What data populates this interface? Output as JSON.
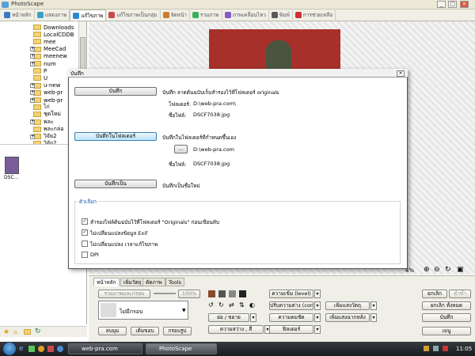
{
  "app": {
    "title": "PhotoScape"
  },
  "tabs": [
    {
      "label": "หน้าหลัก",
      "color": "#3a78c8"
    },
    {
      "label": "แสดงภาพ",
      "color": "#3aa0c8"
    },
    {
      "label": "แก้ไขภาพ",
      "color": "#2a8ad0"
    },
    {
      "label": "แก้ไขภาพเป็นกลุ่ม",
      "color": "#c84a4a"
    },
    {
      "label": "จัดหน้า",
      "color": "#d07a2a"
    },
    {
      "label": "รวมภาพ",
      "color": "#3ab05a"
    },
    {
      "label": "ภาพเคลื่อนไหว",
      "color": "#8a5ac8"
    },
    {
      "label": "พิมพ์",
      "color": "#5a5a5a"
    },
    {
      "label": "การช่วยเหลือ",
      "color": "#d03030"
    }
  ],
  "tree": {
    "items": [
      "Downloads",
      "LocalCDDB",
      "mee",
      "MeeCad",
      "meenew",
      "num",
      "P",
      "U",
      "u-new",
      "web-pr",
      "web-pr",
      "ไก่",
      "ชุดใหม่",
      "พละ",
      "พละกล่อ",
      "วิจัย2",
      "วิจัย2"
    ]
  },
  "thumbnail": {
    "caption": "DSC..."
  },
  "zoom": {
    "value": "4%"
  },
  "dialog": {
    "title": "บันทึก",
    "save_button": "บันทึก",
    "save_desc": "บันทึก  ลาดต้นฉบับเก็บสำรองไว้ที่โฟลเดอร์ originals",
    "folder_label": "โฟลเดอร์:",
    "folder_value": "D:\\web-pra.com\\",
    "filename_label": "ชื่อไฟล์:",
    "filename_value": "DSCF7038.jpg",
    "save_in_folder_button": "บันทึกในโฟลเดอร์",
    "save_in_folder_desc": "บันทึกในโฟลเดอร์ที่กำหนดขึ้นเอง",
    "browse_button": "...",
    "custom_folder_value": "D:\\web-pra.com",
    "custom_filename_label": "ชื่อไฟล์:",
    "custom_filename_value": "DSCF7038.jpg",
    "save_as_button": "บันทึกเป็น",
    "save_as_desc": "บันทึกเป็นชื่อใหม่",
    "options_legend": "ตัวเลือก",
    "options": [
      {
        "label": "สำรองไฟล์ต้นฉบับไว้ที่โฟลเดอร์ \"Originals\" ก่อนเขียนทับ",
        "checked": true
      },
      {
        "label": "ไม่เปลี่ยนแปลงข้อมูล Exif",
        "checked": true
      },
      {
        "label": "ไม่เปลี่ยนแปลง เวลาแก้ไขภาพ",
        "checked": false
      },
      {
        "label": "DPI",
        "checked": false
      }
    ]
  },
  "panel": {
    "tabs": [
      "หน้าหลัก",
      "เพิ่มวัตถุ",
      "ตัดภาพ",
      "Tools"
    ],
    "frame_field": "รวมภาพและกรอบ",
    "percent": "100%",
    "frame_select": "ไม่มีกรอบ",
    "btn_round": "ลบมุม",
    "btn_margin": "เติมขอบ",
    "btn_frame": "กรอบรูป",
    "btn_brightness_level": "ความเข้ม (level)",
    "btn_contrast": "ปรับความต่าง (contra",
    "btn_sharpen": "ความคมชัด",
    "btn_filter": "ฟิลเตอร์",
    "btn_resize": "ย่อ / ขยาย",
    "btn_brightness_color": "ความสว่าง , สี",
    "btn_add_object": "เพิ่มแสงวัตถุ",
    "btn_backlight": "เพิ่มแสงฉากหลัง",
    "btn_undo": "ยกเลิก",
    "btn_redo": "ทำซ้ำ",
    "btn_undo_all": "ยกเลิก ทั้งหมด",
    "btn_save": "บันทึก",
    "btn_menu": "เมนู"
  },
  "taskbar": {
    "items": [
      "web-pra.com",
      "PhotoScape"
    ],
    "clock": "11:05"
  }
}
